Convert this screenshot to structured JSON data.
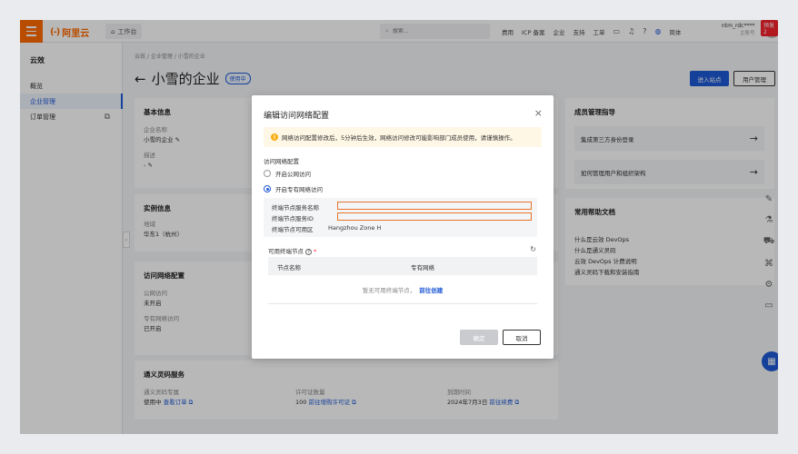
{
  "topbar": {
    "brand": "阿里云",
    "logo_mark": "(-)",
    "workbench": "工作台",
    "search_placeholder": "搜索...",
    "nav": [
      "费用",
      "ICP 备案",
      "企业",
      "支持",
      "工单"
    ],
    "language": "简体",
    "user_name": "ntm_rdc****",
    "user_sub": "主账号",
    "promo_badge": "预发2"
  },
  "sidebar": {
    "title": "云效",
    "items": [
      {
        "label": "概览"
      },
      {
        "label": "企业管理"
      },
      {
        "label": "订单管理"
      }
    ]
  },
  "breadcrumb": {
    "items": [
      "云效",
      "企业管理",
      "小雪的企业"
    ],
    "sep": "/"
  },
  "page": {
    "title": "小雪的企业",
    "back_arrow": "←",
    "status": "使用中",
    "enter_site": "进入站点",
    "user_manage": "用户管理"
  },
  "basic_info": {
    "title": "基本信息",
    "name_label": "企业名称",
    "name_value": "小雪的企业",
    "desc_label": "描述",
    "desc_value": "-"
  },
  "instance_info": {
    "title": "实例信息",
    "region_label": "地域",
    "region_value": "华东1（杭州）"
  },
  "network_card": {
    "title": "访问网络配置",
    "public_label": "公网访问",
    "public_value": "未开启",
    "private_label": "专有网络访问",
    "private_value": "已开启"
  },
  "lingma": {
    "title": "通义灵码服务",
    "col1_label": "通义灵码专属",
    "col1_value": "使用中",
    "col1_link": "查看订单",
    "col2_label": "许可证数量",
    "col2_value": "100",
    "col2_link": "前往增购许可证",
    "col3_label": "到期时间",
    "col3_value": "2024年7月3日",
    "col3_link": "前往续费"
  },
  "member_guide": {
    "title": "成员管理指导",
    "items": [
      "集成第三方身份登录",
      "如何管理用户和组织架构"
    ],
    "arrow": "→"
  },
  "help_docs": {
    "title": "常用帮助文档",
    "links": [
      "什么是云效 DevOps",
      "什么是通义灵码",
      "云效 DevOps 计费说明",
      "通义灵码下载和安装指南"
    ]
  },
  "modal": {
    "title": "编辑访问网络配置",
    "close": "×",
    "alert": "网络访问配置修改后，5分钟后生效，网络访问修改可能影响部门成员使用，请谨慎操作。",
    "alert_icon": "!",
    "section_label": "访问网络配置",
    "radio_public": "开启公网访问",
    "radio_private": "开启专有网络访问",
    "selected": "private",
    "endpoint_name_label": "终端节点服务名称",
    "endpoint_id_label": "终端节点服务ID",
    "endpoint_zone_label": "终端节点可用区",
    "endpoint_zone_value": "Hangzhou Zone H",
    "available_label": "可用终端节点",
    "required_mark": "*",
    "help_mark": "?",
    "refresh": "↻",
    "col_name": "节点名称",
    "col_vpc": "专有网络",
    "empty_text": "暂无可用终端节点，",
    "empty_link": "前往创建",
    "confirm": "确定",
    "cancel": "取消"
  },
  "colors": {
    "brand": "#ff6a00",
    "primary": "#1f5ad6",
    "redact": "#e8732b",
    "warning": "#faad14"
  }
}
